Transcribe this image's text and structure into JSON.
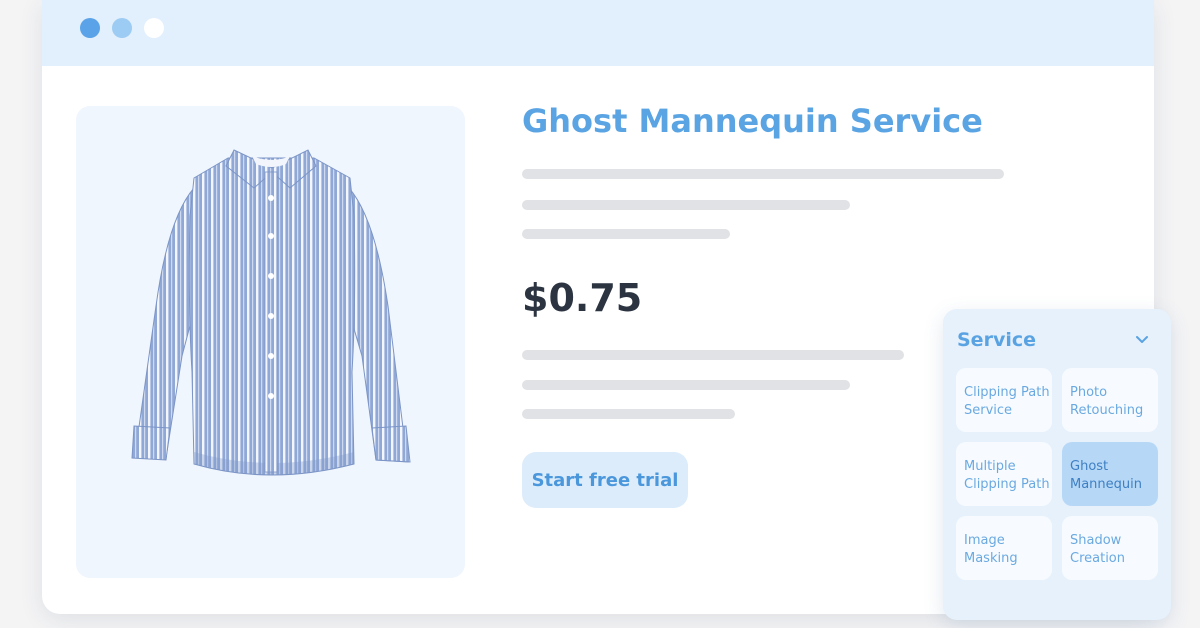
{
  "window": {
    "controls": [
      "close",
      "minimize",
      "maximize"
    ]
  },
  "product": {
    "title": "Ghost Mannequin Service",
    "price": "$0.75",
    "cta_label": "Start free trial",
    "image_subject": "blue striped long-sleeve button-down shirt"
  },
  "service_panel": {
    "title": "Service",
    "toggle_icon": "chevron-down-icon",
    "options": [
      {
        "line1": "Clipping Path",
        "line2": "Service",
        "selected": false
      },
      {
        "line1": "Photo",
        "line2": "Retouching",
        "selected": false
      },
      {
        "line1": "Multiple",
        "line2": "Clipping Path",
        "selected": false
      },
      {
        "line1": "Ghost",
        "line2": "Mannequin",
        "selected": true
      },
      {
        "line1": "Image",
        "line2": "Masking",
        "selected": false
      },
      {
        "line1": "Shadow",
        "line2": "Creation",
        "selected": false
      }
    ]
  },
  "colors": {
    "accent": "#5aa4e3",
    "titlebar": "#e2effc",
    "panel": "#e6f1fc",
    "selected_tile": "#b6d8f6",
    "price_text": "#2b3440"
  }
}
